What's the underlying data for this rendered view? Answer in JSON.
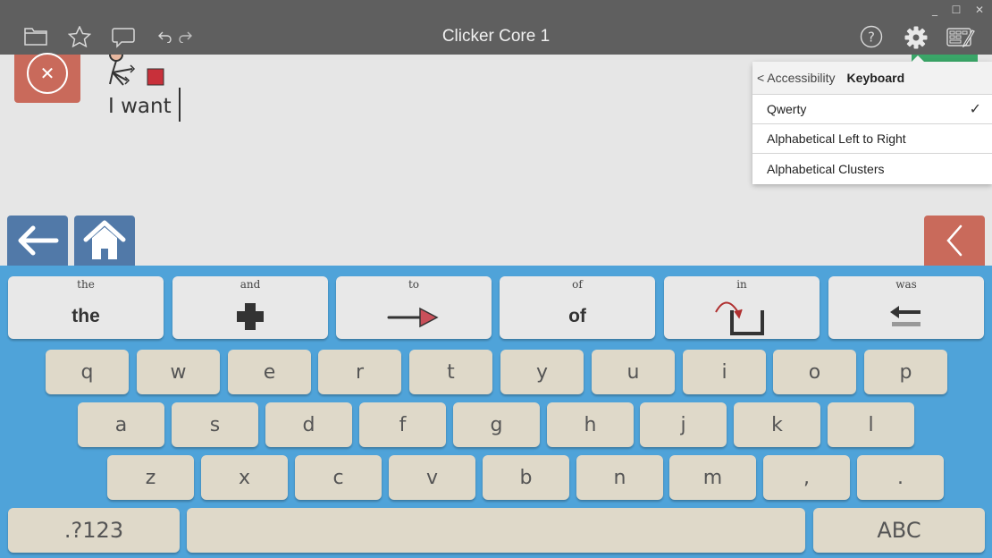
{
  "app": {
    "title": "Clicker Core 1"
  },
  "toolbar": {
    "left_icons": [
      "folder-icon",
      "star-icon",
      "speech-bubble-icon",
      "undo-icon",
      "redo-icon"
    ],
    "right_icons": [
      "help-icon",
      "settings-icon",
      "keyboard-edit-icon"
    ],
    "window_controls": {
      "minimize": "_",
      "maximize": "☐",
      "close": "✕"
    }
  },
  "document": {
    "text": "I want",
    "symbol": "want-symbol"
  },
  "nav": {
    "back_icon": "back-arrow-icon",
    "home_icon": "home-icon",
    "collapse_icon": "chevron-left-icon"
  },
  "settings_popup": {
    "back_label": "< Accessibility",
    "current_label": "Keyboard",
    "options": [
      {
        "label": "Qwerty",
        "selected": true,
        "check": "✓"
      },
      {
        "label": "Alphabetical Left to Right",
        "selected": false
      },
      {
        "label": "Alphabetical Clusters",
        "selected": false
      }
    ]
  },
  "word_keys": [
    {
      "label": "the",
      "display": "the",
      "type": "text"
    },
    {
      "label": "and",
      "symbol": "plus-symbol",
      "type": "symbol"
    },
    {
      "label": "to",
      "symbol": "arrow-right-symbol",
      "type": "symbol"
    },
    {
      "label": "of",
      "display": "of",
      "type": "text"
    },
    {
      "label": "in",
      "symbol": "in-container-symbol",
      "type": "symbol"
    },
    {
      "label": "was",
      "symbol": "past-arrow-symbol",
      "type": "symbol"
    }
  ],
  "keyboard": {
    "row1": [
      "q",
      "w",
      "e",
      "r",
      "t",
      "y",
      "u",
      "i",
      "o",
      "p"
    ],
    "row2": [
      "a",
      "s",
      "d",
      "f",
      "g",
      "h",
      "j",
      "k",
      "l"
    ],
    "row3": [
      "z",
      "x",
      "c",
      "v",
      "b",
      "n",
      "m",
      ",",
      "."
    ],
    "numbers_label": ".?123",
    "space_label": "",
    "abc_label": "ABC"
  },
  "colors": {
    "titlebar": "#5f5f5f",
    "keyboard_bg": "#4fa3d9",
    "key_bg": "#dfd9c9",
    "word_key_bg": "#e8e8e8",
    "nav_blue": "#5179a8",
    "accent_red": "#c96a5b",
    "accent_green": "#3aa668"
  }
}
